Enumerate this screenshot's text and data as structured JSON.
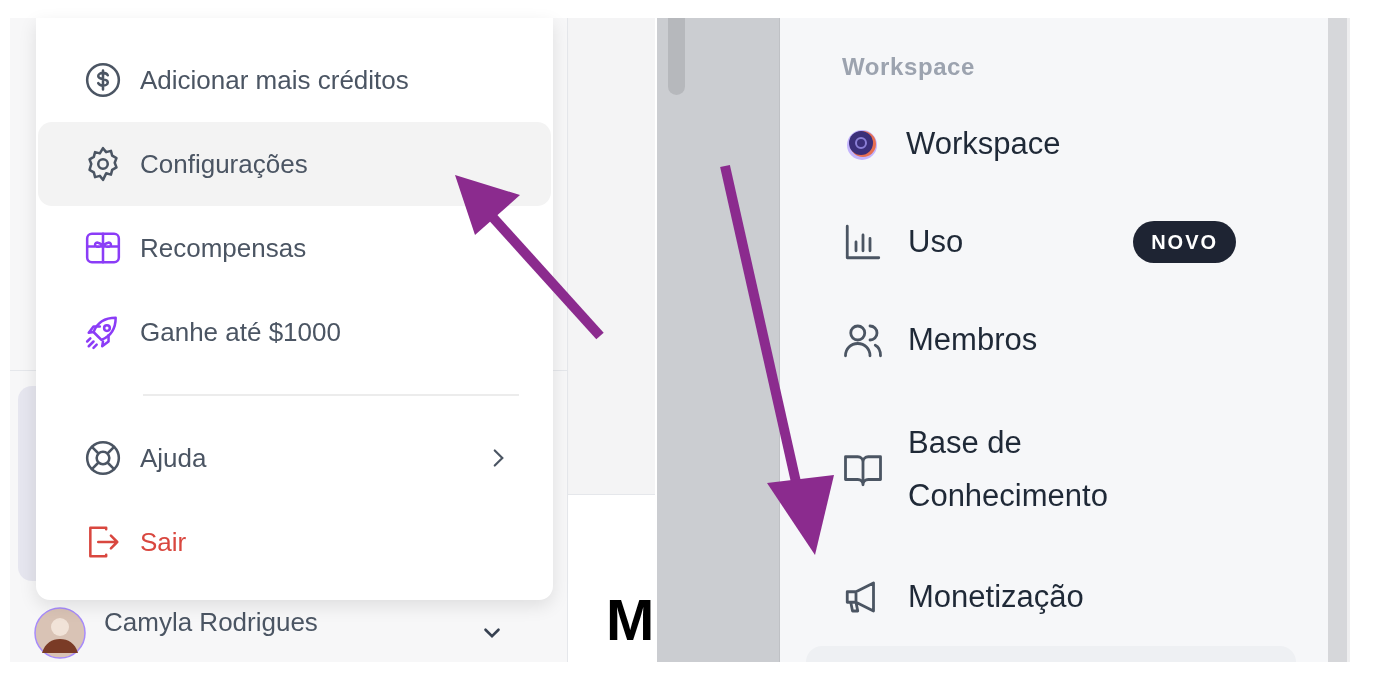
{
  "account_menu": {
    "groups": [
      [
        {
          "kind": "dollar",
          "label": "Adicionar mais créditos",
          "selected": false,
          "danger": false,
          "submenu": false
        },
        {
          "kind": "gear",
          "label": "Configurações",
          "selected": true,
          "danger": false,
          "submenu": false
        },
        {
          "kind": "gift",
          "label": "Recompensas",
          "selected": false,
          "danger": false,
          "submenu": false
        },
        {
          "kind": "rocket",
          "label": "Ganhe até $1000",
          "selected": false,
          "danger": false,
          "submenu": false
        }
      ],
      [
        {
          "kind": "lifebuoy",
          "label": "Ajuda",
          "selected": false,
          "danger": false,
          "submenu": true
        },
        {
          "kind": "logout",
          "label": "Sair",
          "selected": false,
          "danger": true,
          "submenu": false
        }
      ]
    ]
  },
  "user": {
    "name": "Camyla Rodrigues"
  },
  "main_heading": "M",
  "settings_sidebar": {
    "section_title": "Workspace",
    "items": [
      {
        "kind": "workspace",
        "label": "Workspace"
      },
      {
        "kind": "chart",
        "label": "Uso",
        "badge": "NOVO"
      },
      {
        "kind": "people",
        "label": "Membros"
      },
      {
        "kind": "book",
        "label": "Base de Conhecimento"
      },
      {
        "kind": "megaphone",
        "label": "Monetização"
      }
    ]
  }
}
